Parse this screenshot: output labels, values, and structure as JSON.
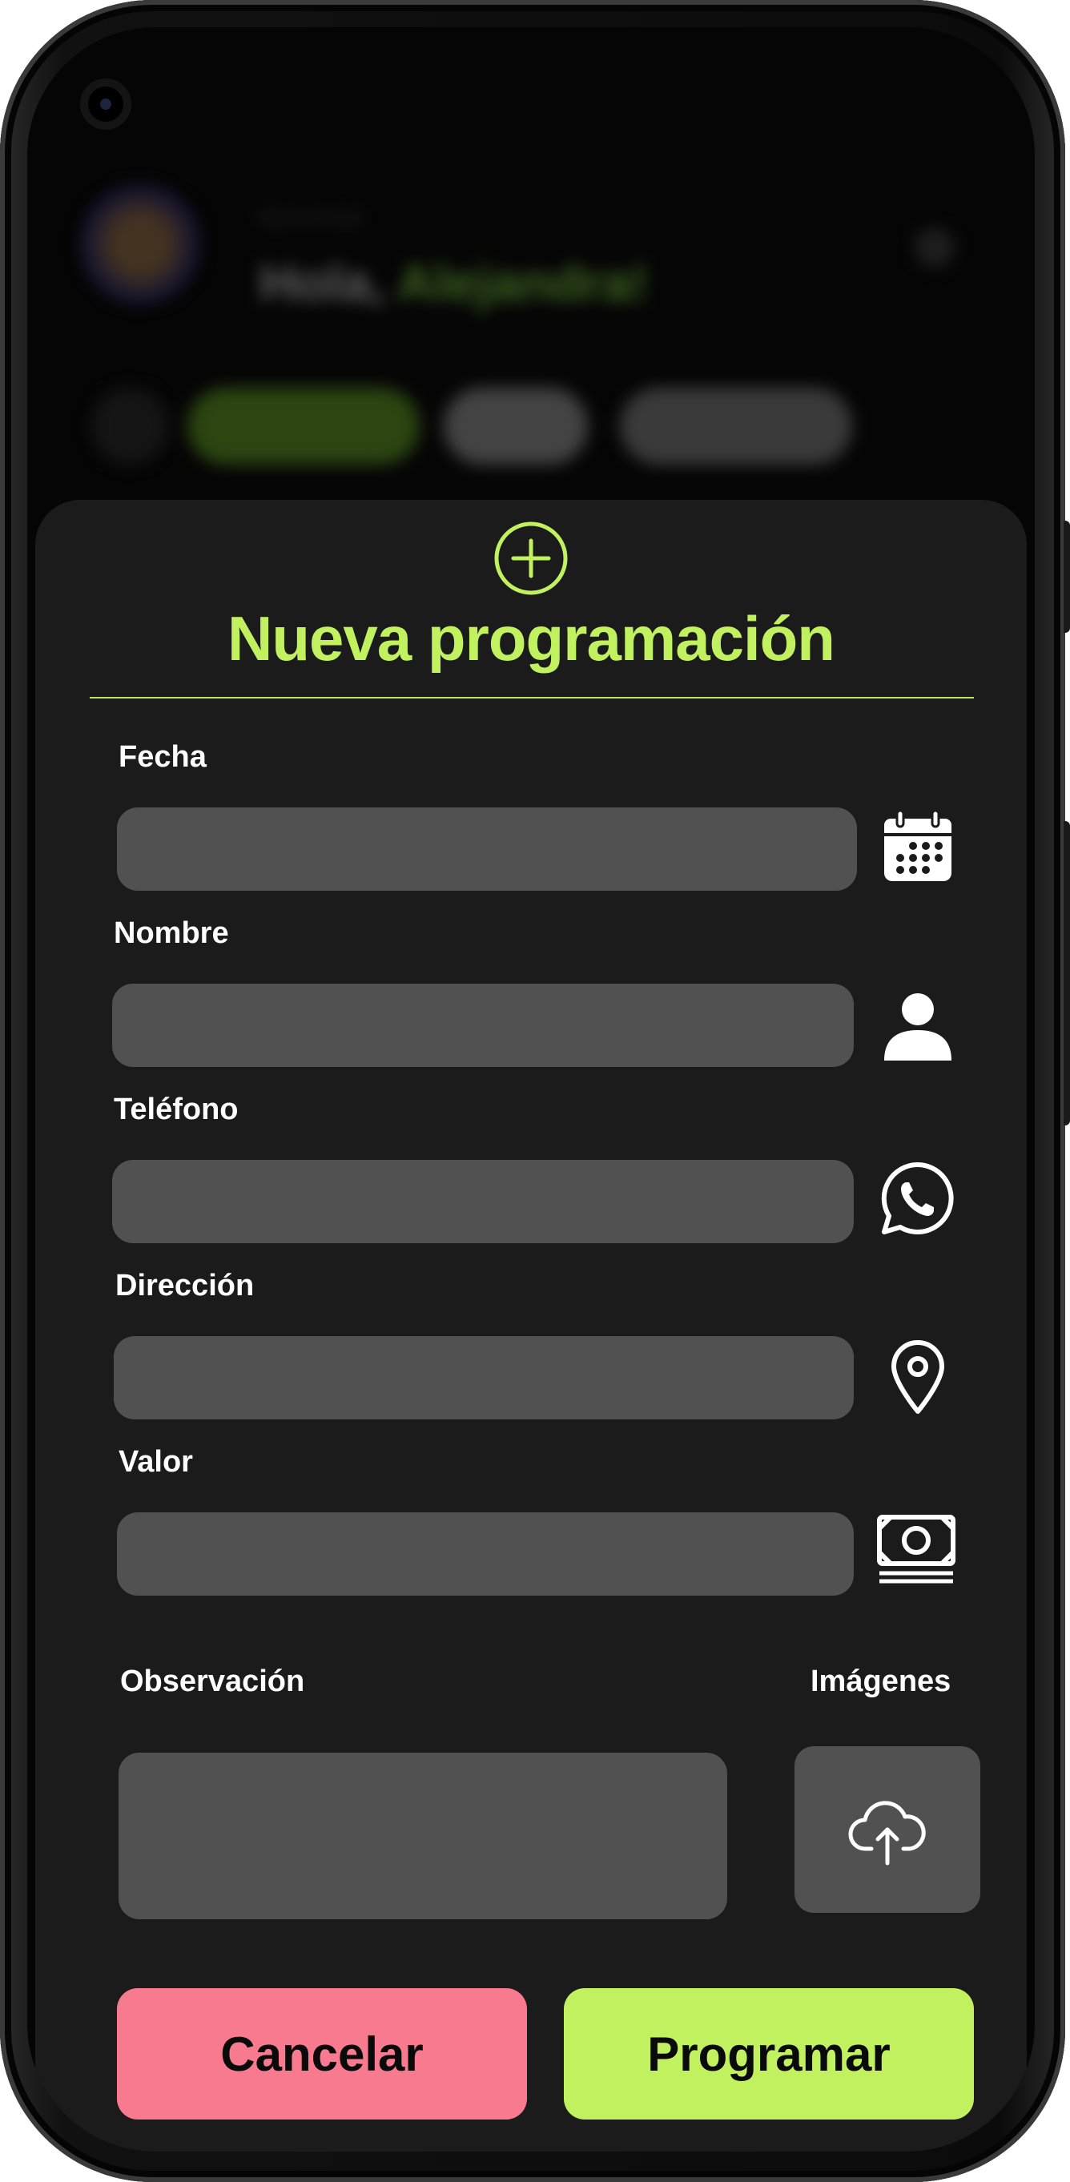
{
  "background_app": {
    "greeting": "Hola,",
    "greeting_name": "Alejandra!",
    "small_text": "Bienvenida"
  },
  "modal": {
    "title": "Nueva programación",
    "accent_color": "#c2f15f",
    "fields": {
      "fecha": {
        "label": "Fecha",
        "value": "",
        "icon": "calendar-icon"
      },
      "nombre": {
        "label": "Nombre",
        "value": "",
        "icon": "user-icon"
      },
      "telefono": {
        "label": "Teléfono",
        "value": "",
        "icon": "whatsapp-icon"
      },
      "direccion": {
        "label": "Dirección",
        "value": "",
        "icon": "location-pin-icon"
      },
      "valor": {
        "label": "Valor",
        "value": "",
        "icon": "money-icon"
      },
      "observacion": {
        "label": "Observación",
        "value": ""
      },
      "imagenes": {
        "label": "Imágenes",
        "icon": "cloud-upload-icon"
      }
    },
    "buttons": {
      "cancel": {
        "label": "Cancelar",
        "color": "#f87a8f"
      },
      "submit": {
        "label": "Programar",
        "color": "#c2f15f"
      }
    }
  }
}
